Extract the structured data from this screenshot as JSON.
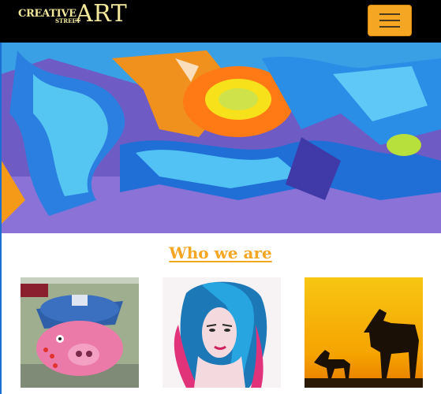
{
  "navbar": {
    "brand": {
      "word1": "CREATIVE",
      "word2": "STREET",
      "word3": "ART"
    },
    "toggler_icon": "hamburger-menu-icon"
  },
  "hero": {
    "image": "graffiti-mural-banner"
  },
  "section": {
    "title": "Who we are"
  },
  "gallery": [
    {
      "image": "pig-police-graffiti"
    },
    {
      "image": "blue-haired-woman-portrait"
    },
    {
      "image": "horses-sunset-silhouette"
    }
  ],
  "colors": {
    "navbar_bg": "#000000",
    "accent": "#f5a623",
    "brand_text": "#f3e79a"
  }
}
